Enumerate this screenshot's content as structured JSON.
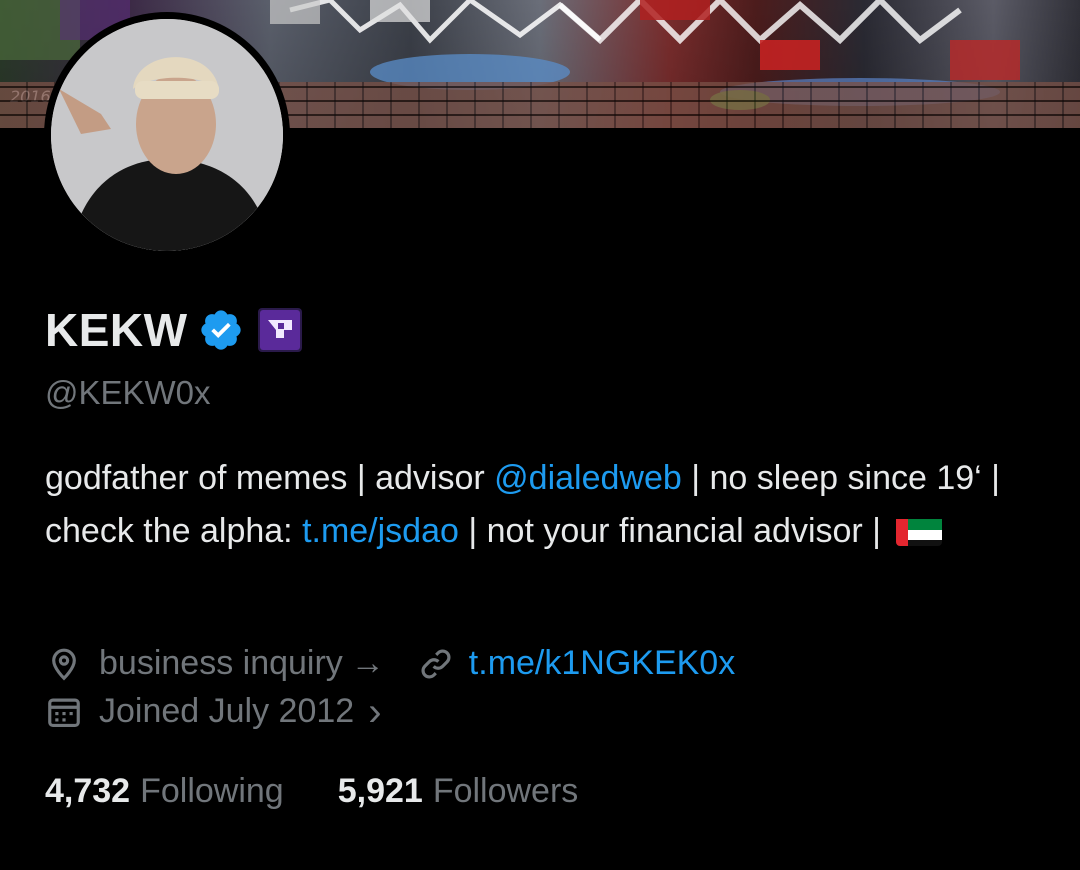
{
  "profile": {
    "display_name": "KEKW",
    "handle": "@KEKW0x",
    "verified_icon": "verified-badge-icon",
    "affiliate_icon": "affiliate-logo-icon",
    "bio_parts": {
      "p1": "godfather of memes | advisor ",
      "mention": "@dialedweb",
      "p2": "  | no sleep since 19‘ | check the alpha: ",
      "bio_link": "t.me/jsdao",
      "p3": " | not your financial advisor | "
    },
    "flag_icon": "uae-flag-icon",
    "location": "business inquiry",
    "location_arrow": "→",
    "website": "t.me/k1NGKEK0x",
    "joined": "Joined July 2012",
    "joined_chevron": "›",
    "following_count": "4,732",
    "following_label": "Following",
    "followers_count": "5,921",
    "followers_label": "Followers"
  },
  "banner": {
    "year_tag": "2016."
  },
  "colors": {
    "background": "#000000",
    "text_primary": "#e7e9ea",
    "text_secondary": "#71767b",
    "link": "#1d9bf0",
    "verified": "#1d9bf0"
  }
}
